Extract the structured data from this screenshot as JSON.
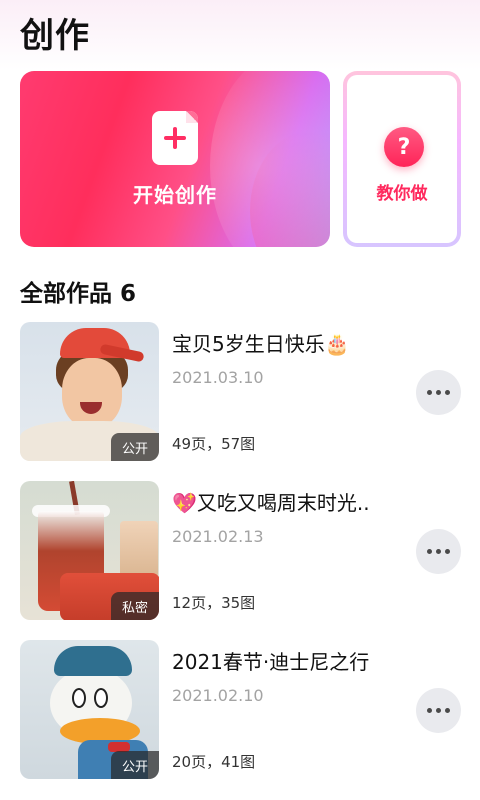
{
  "header": {
    "title": "创作"
  },
  "create_card": {
    "label": "开始创作",
    "icon": "plus-icon"
  },
  "tutorial_card": {
    "label": "教你做",
    "icon_glyph": "?"
  },
  "section": {
    "title": "全部作品",
    "count": "6"
  },
  "works": [
    {
      "title": "宝贝5岁生日快乐🎂",
      "date": "2021.03.10",
      "stats": "49页，57图",
      "privacy": "公开",
      "thumbnail": "child-red-cap"
    },
    {
      "title": "💖又吃又喝周末时光..",
      "date": "2021.02.13",
      "stats": "12页，35图",
      "privacy": "私密",
      "thumbnail": "drinks"
    },
    {
      "title": "2021春节·迪士尼之行",
      "date": "2021.02.10",
      "stats": "20页，41图",
      "privacy": "公开",
      "thumbnail": "duck-figure"
    }
  ],
  "colors": {
    "accent": "#ff2e63",
    "muted_text": "#a3a3a3",
    "more_button_bg": "#e9eaee"
  }
}
